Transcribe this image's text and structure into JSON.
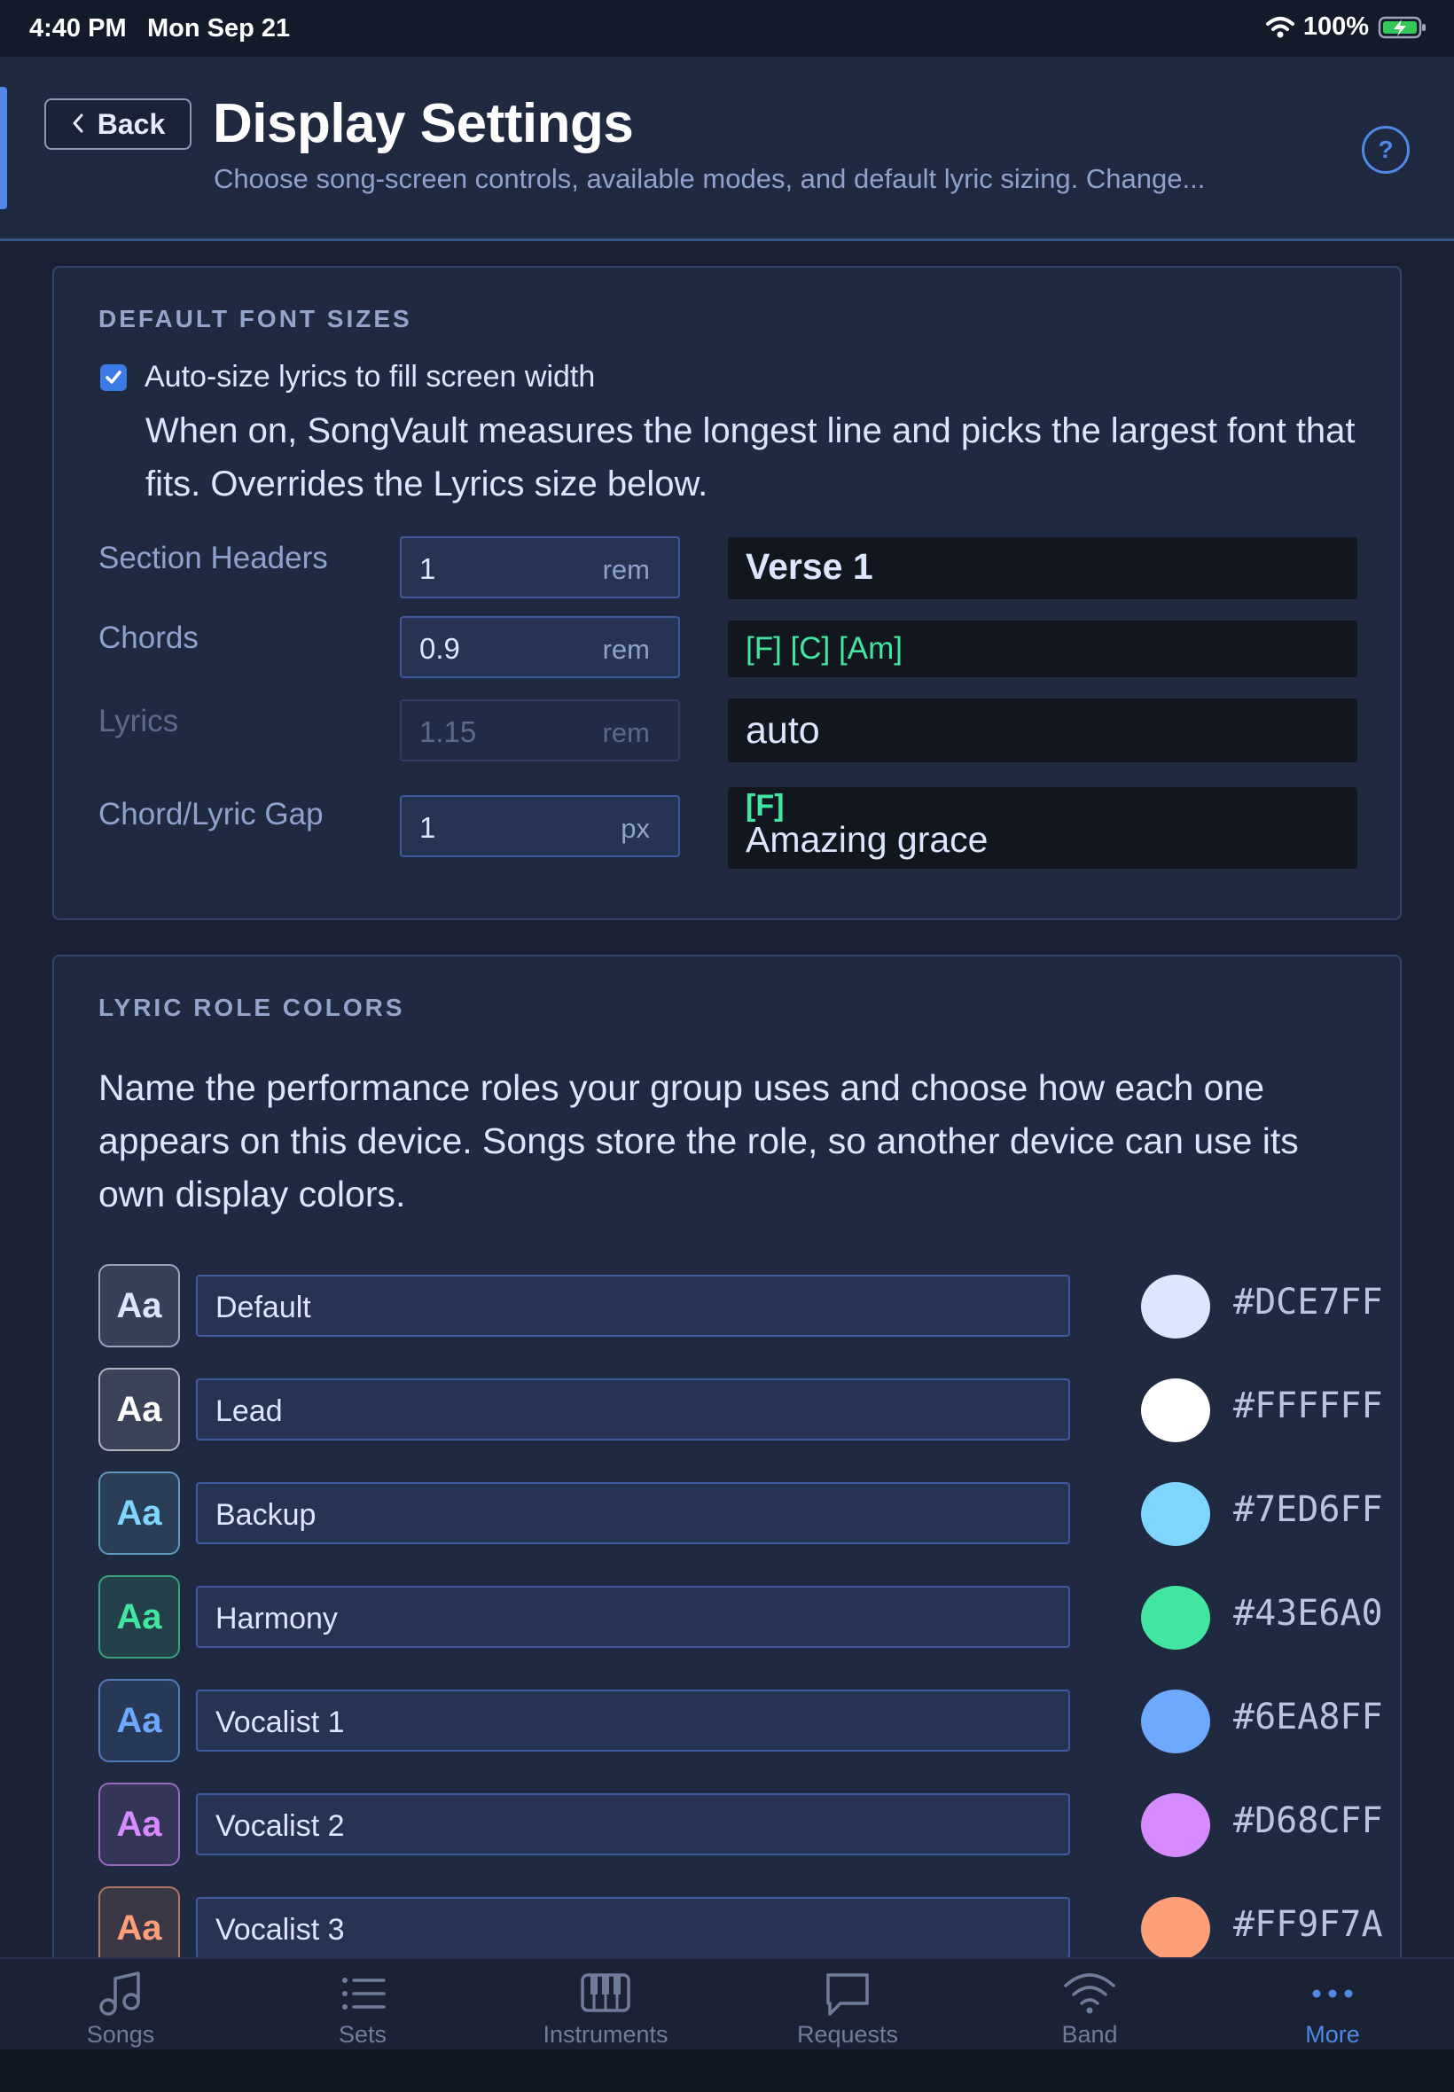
{
  "status_bar": {
    "time": "4:40 PM",
    "date": "Mon Sep 21",
    "battery": "100%"
  },
  "header": {
    "back_label": "Back",
    "title": "Display Settings",
    "subtitle": "Choose song-screen controls, available modes, and default lyric sizing. Change...",
    "help_label": "?"
  },
  "font_sizes": {
    "title": "DEFAULT FONT SIZES",
    "auto_size": {
      "checked": true,
      "label": "Auto-size lyrics to fill screen width",
      "description": "When on, SongVault measures the longest line and picks the largest font that fits. Overrides the Lyrics size below."
    },
    "rows": [
      {
        "label": "Section Headers",
        "value": "1",
        "unit": "rem",
        "preview": "Verse 1",
        "disabled": false
      },
      {
        "label": "Chords",
        "value": "0.9",
        "unit": "rem",
        "preview": "[F] [C] [Am]",
        "disabled": false
      },
      {
        "label": "Lyrics",
        "value": "1.15",
        "unit": "rem",
        "preview": "auto",
        "disabled": true
      },
      {
        "label": "Chord/Lyric Gap",
        "value": "1",
        "unit": "px",
        "preview_chord": "[F]",
        "preview_lyric": "Amazing grace",
        "disabled": false
      }
    ]
  },
  "role_colors": {
    "title": "LYRIC ROLE COLORS",
    "description": "Name the performance roles your group uses and choose how each one appears on this device. Songs store the role, so another device can use its own display colors.",
    "badge_text": "Aa",
    "roles": [
      {
        "name": "Default",
        "hex": "#DCE7FF",
        "color": "#DCE7FF"
      },
      {
        "name": "Lead",
        "hex": "#FFFFFF",
        "color": "#FFFFFF"
      },
      {
        "name": "Backup",
        "hex": "#7ED6FF",
        "color": "#7ED6FF"
      },
      {
        "name": "Harmony",
        "hex": "#43E6A0",
        "color": "#43E6A0"
      },
      {
        "name": "Vocalist 1",
        "hex": "#6EA8FF",
        "color": "#6EA8FF"
      },
      {
        "name": "Vocalist 2",
        "hex": "#D68CFF",
        "color": "#D68CFF"
      },
      {
        "name": "Vocalist 3",
        "hex": "#FF9F7A",
        "color": "#FF9F7A"
      }
    ]
  },
  "tabs": [
    {
      "label": "Songs",
      "icon": "music-note-icon",
      "active": false
    },
    {
      "label": "Sets",
      "icon": "list-icon",
      "active": false
    },
    {
      "label": "Instruments",
      "icon": "keyboard-icon",
      "active": false
    },
    {
      "label": "Requests",
      "icon": "chat-bubble-icon",
      "active": false
    },
    {
      "label": "Band",
      "icon": "wifi-icon",
      "active": false
    },
    {
      "label": "More",
      "icon": "more-dots-icon",
      "active": true
    }
  ],
  "colors": {
    "accent": "#4F88E6",
    "background": "#1A2133",
    "card": "#1F2940",
    "chord": "#43E6A0"
  }
}
